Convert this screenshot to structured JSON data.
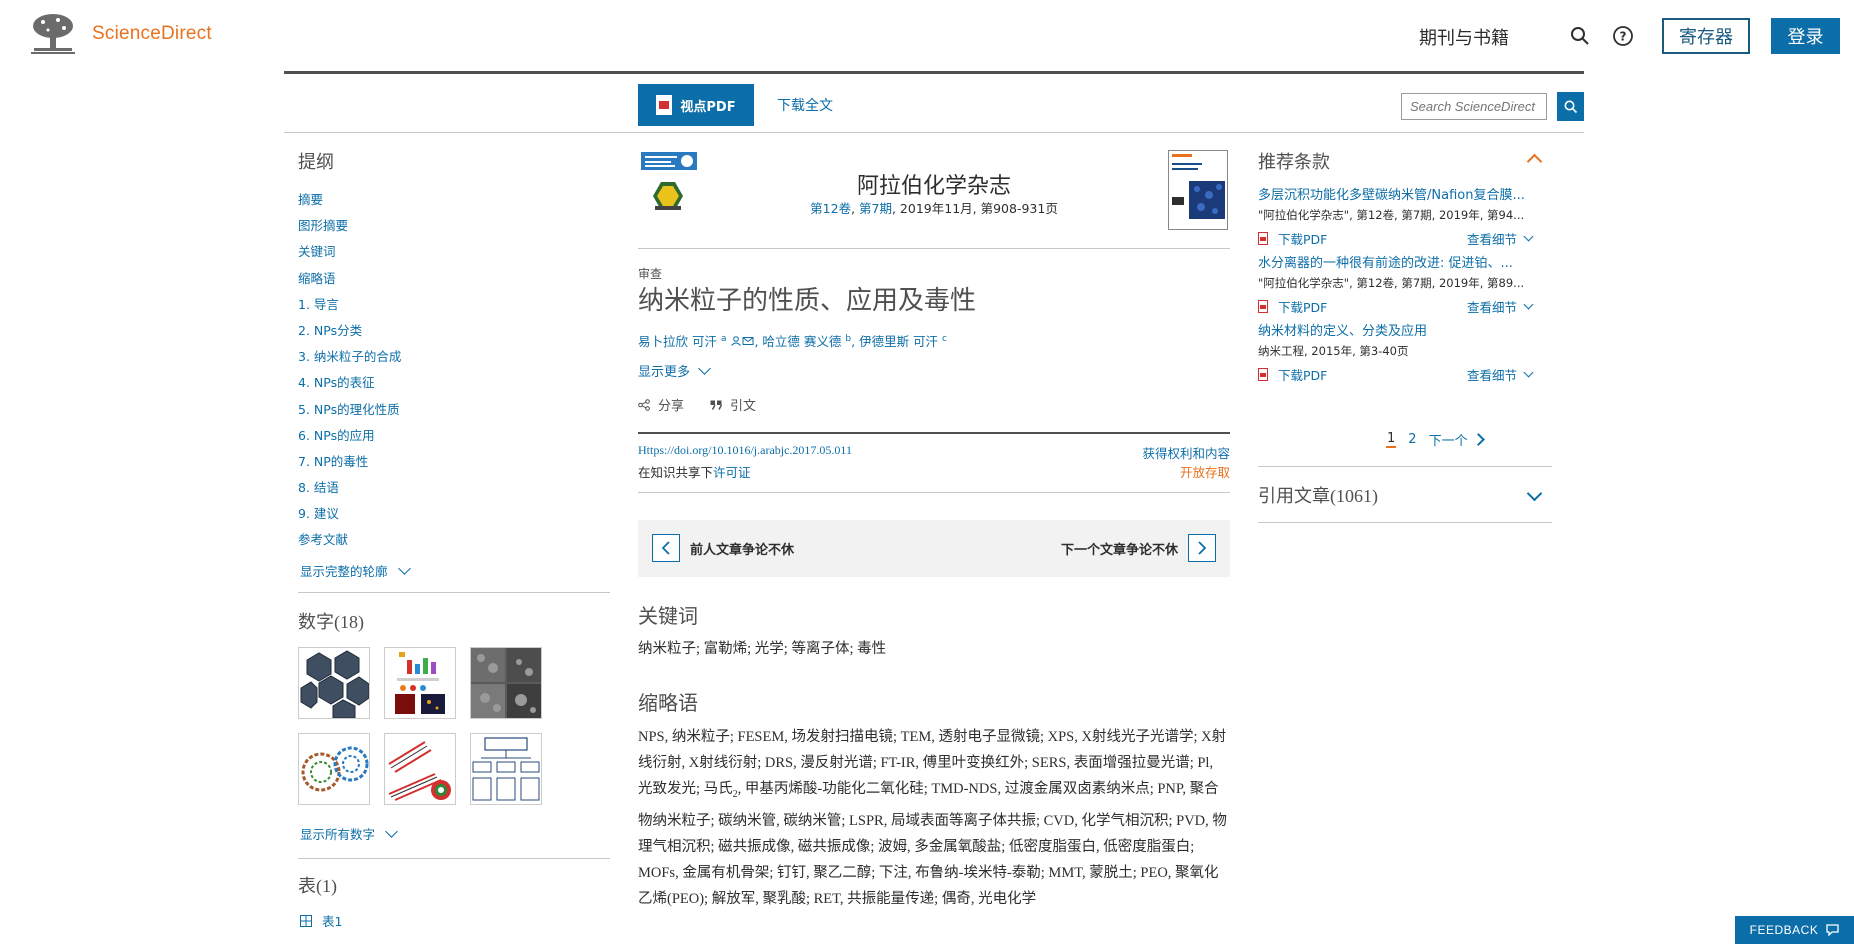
{
  "header": {
    "logo_text": "ScienceDirect",
    "nav_journals": "期刊与书籍",
    "register_label": "寄存器",
    "login_label": "登录"
  },
  "toolbar": {
    "view_pdf_label": "视点PDF",
    "download_full_label": "下载全文",
    "search_placeholder": "Search ScienceDirect"
  },
  "outline": {
    "title": "提纲",
    "items": [
      "摘要",
      "图形摘要",
      "关键词",
      "缩略语",
      "1. 导言",
      "2. NPs分类",
      "3. 纳米粒子的合成",
      "4. NPs的表征",
      "5. NPs的理化性质",
      "6. NPs的应用",
      "7. NP的毒性",
      "8. 结语",
      "9. 建议",
      "参考文献"
    ],
    "show_full": "显示完整的轮廓"
  },
  "figures": {
    "title": "数字(18)",
    "show_all": "显示所有数字"
  },
  "tables": {
    "title": "表(1)",
    "item": "表1"
  },
  "article": {
    "journal_title": "阿拉伯化学杂志",
    "issue_volume": "第12卷",
    "issue_number": "第7期",
    "issue_rest": ", 2019年11月, 第908-931页",
    "type": "审查",
    "title": "纳米粒子的性质、应用及毒性",
    "author_1": "易卜拉欣 可汗",
    "author_1_sup": "a",
    "author_2": "哈立德 赛义德",
    "author_2_sup": "b",
    "author_3": "伊德里斯 可汗",
    "author_3_sup": "c",
    "show_more": "显示更多",
    "share": "分享",
    "cite": "引文",
    "doi": "Https://doi.org/10.1016/j.arabjc.2017.05.011",
    "rights": "获得权利和内容",
    "license_prefix": "在知识共享下",
    "license_link": "许可证",
    "open_access": "开放存取",
    "prev_article": "前人文章争论不休",
    "next_article": "下一个文章争论不休",
    "keywords_heading": "关键词",
    "keywords": "纳米粒子; 富勒烯; 光学; 等离子体; 毒性",
    "abbr_heading": "缩略语",
    "abbr_part1": "NPS, 纳米粒子; FESEM, 场发射扫描电镜; TEM, 透射电子显微镜; XPS, X射线光子光谱学; X射线衍射, X射线衍射; DRS, 漫反射光谱; FT-IR, 傅里叶变换红外; SERS, 表面增强拉曼光谱; Pl, 光致发光; 马氏",
    "abbr_sub": "2",
    "abbr_part2": ", 甲基丙烯酸-功能化二氧化硅; TMD-NDS, 过渡金属双卤素纳米点; PNP, 聚合物纳米粒子; 碳纳米管, 碳纳米管; LSPR, 局域表面等离子体共振; CVD, 化学气相沉积; PVD, 物理气相沉积; 磁共振成像, 磁共振成像; 波姆, 多金属氧酸盐; 低密度脂蛋白, 低密度脂蛋白; MOFs, 金属有机骨架; 钉钉, 聚乙二醇; 下注, 布鲁纳-埃米特-泰勒; MMT, 蒙脱土; PEO, 聚氧化乙烯(PEO); 解放军, 聚乳酸; RET, 共振能量传递; 偶奇, 光电化学"
  },
  "recommended": {
    "title": "推荐条款",
    "items": [
      {
        "title": "多层沉积功能化多壁碳纳米管/Nafion复合膜...",
        "source": "\"阿拉伯化学杂志\", 第12卷, 第7期, 2019年, 第94...",
        "pdf": "下载PDF",
        "details": "查看细节"
      },
      {
        "title": "水分离器的一种很有前途的改进: 促进铂、...",
        "source": "\"阿拉伯化学杂志\", 第12卷, 第7期, 2019年, 第89...",
        "pdf": "下载PDF",
        "details": "查看细节"
      },
      {
        "title": "纳米材料的定义、分类及应用",
        "source": "纳米工程, 2015年, 第3-40页",
        "pdf": "下载PDF",
        "details": "查看细节"
      }
    ],
    "page_1": "1",
    "page_2": "2",
    "next": "下一个"
  },
  "cited": {
    "title": "引用文章(1061)"
  },
  "feedback": {
    "label": "FEEDBACK"
  },
  "colors": {
    "brand_orange": "#e9711c",
    "link_blue": "#0c6ea8",
    "dark_text": "#2e2e2e"
  }
}
